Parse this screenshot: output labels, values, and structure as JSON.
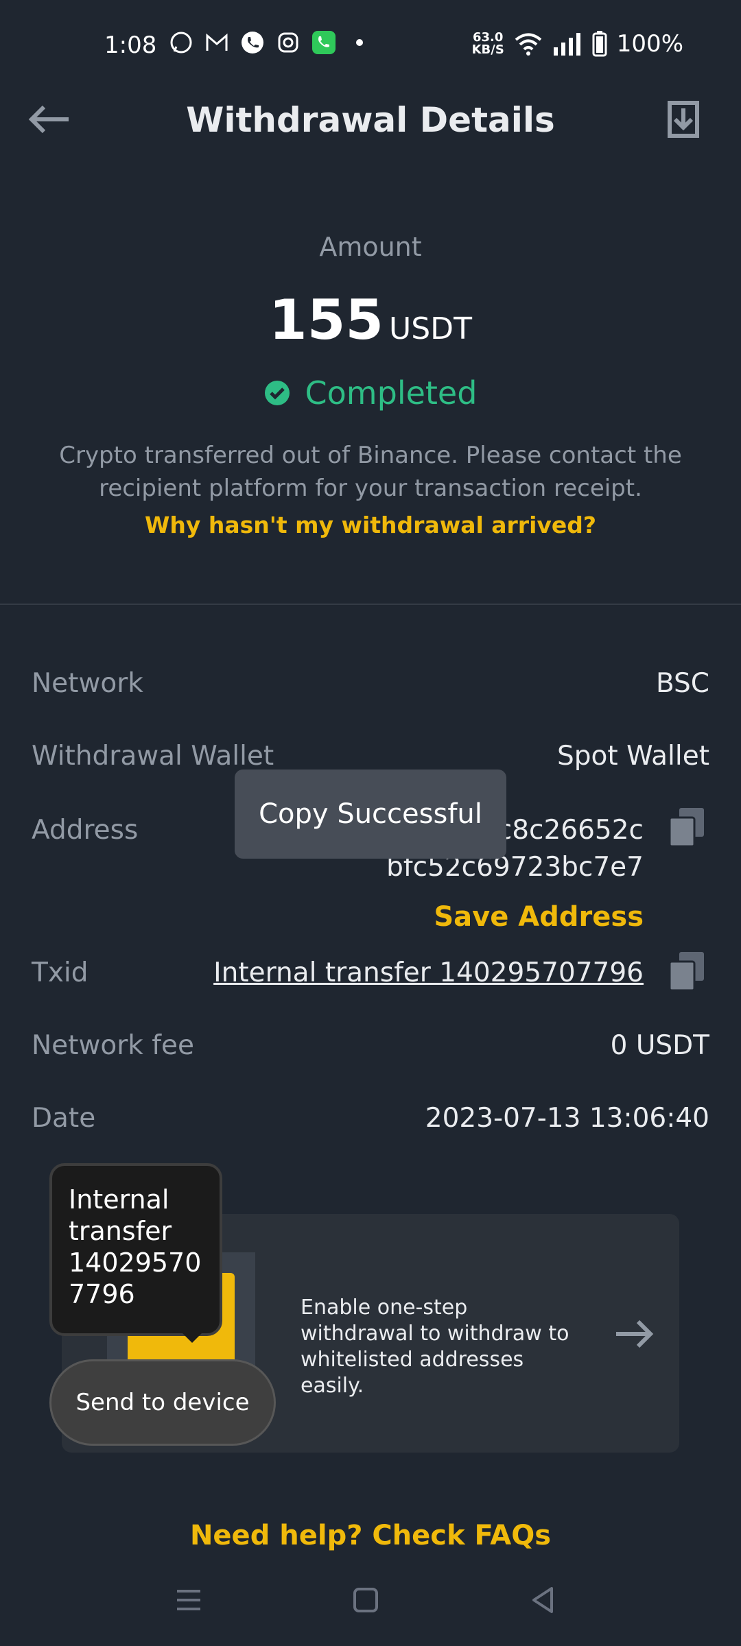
{
  "status_bar": {
    "time": "1:08",
    "net_speed": "63.0",
    "net_unit": "KB/S",
    "battery": "100%",
    "left_icons": [
      "whatsapp-icon",
      "gmail-icon",
      "phone-call-icon",
      "instagram-icon",
      "green-phone-icon",
      "dot-icon"
    ],
    "right_icons": [
      "wifi-icon",
      "signal-icon",
      "battery-icon"
    ]
  },
  "header": {
    "title": "Withdrawal Details"
  },
  "summary": {
    "amount_label": "Amount",
    "amount": "155",
    "unit": "USDT",
    "status": "Completed",
    "status_color": "#2ebd85",
    "description": "Crypto transferred out of Binance. Please contact the recipient platform for your transaction receipt.",
    "why_link": "Why hasn't my withdrawal arrived?"
  },
  "details": {
    "network_label": "Network",
    "network_value": "BSC",
    "wallet_label": "Withdrawal Wallet",
    "wallet_value": "Spot Wallet",
    "address_label": "Address",
    "address_line1": "c8c26652c",
    "address_line2": "bfc52c69723bc7e7",
    "save_address": "Save Address",
    "txid_label": "Txid",
    "txid_value": "Internal transfer 140295707796",
    "fee_label": "Network fee",
    "fee_value": "0 USDT",
    "date_label": "Date",
    "date_value": "2023-07-13 13:06:40"
  },
  "toast": "Copy Successful",
  "popup": {
    "lines": [
      "Internal",
      "transfer",
      "14029570",
      "7796"
    ],
    "send_button": "Send to device"
  },
  "promo": {
    "text": "Enable one-step withdrawal to withdraw to whitelisted addresses easily."
  },
  "footer": {
    "faq_link": "Need help? Check FAQs"
  },
  "colors": {
    "accent": "#f0b90b",
    "background": "#1f2630",
    "muted": "#929aa5"
  }
}
